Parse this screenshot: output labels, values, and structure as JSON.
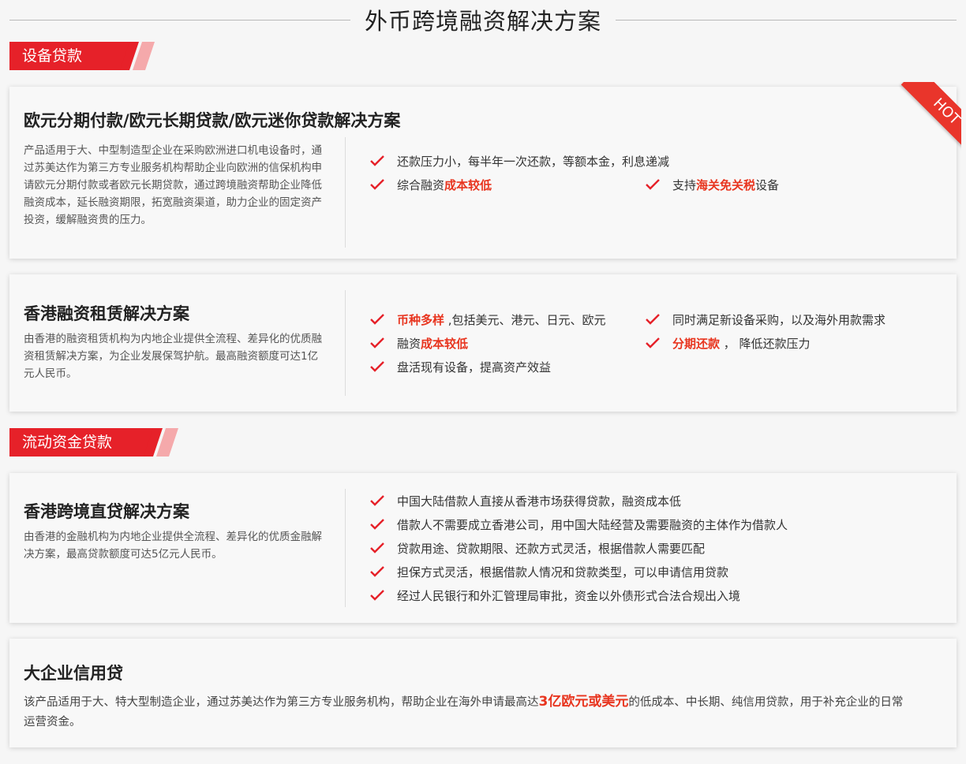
{
  "page_title": "外币跨境融资解决方案",
  "colors": {
    "accent": "#e62129",
    "highlight": "#e8351f"
  },
  "sections": [
    {
      "tag": "设备贷款",
      "cards": [
        {
          "title": "欧元分期付款/欧元长期贷款/欧元迷你贷款解决方案",
          "badge": "HOT",
          "description": "产品适用于大、中型制造型企业在采购欧洲进口机电设备时，通过苏美达作为第三方专业服务机构帮助企业向欧洲的信保机构申请欧元分期付款或者欧元长期贷款，通过跨境融资帮助企业降低融资成本，延长融资期限，拓宽融资渠道，助力企业的固定资产投资，缓解融资贵的压力。",
          "features": [
            {
              "plain_before": "还款压力小，每半年一次还款，等额本金，利息递减",
              "highlight": "",
              "plain_after": ""
            },
            {
              "plain_before": "综合融资",
              "highlight": "成本较低",
              "plain_after": ""
            },
            {
              "plain_before": "支持",
              "highlight": "海关免关税",
              "plain_after": "设备"
            }
          ]
        }
      ]
    },
    {
      "cards": [
        {
          "title": "香港融资租赁解决方案",
          "description": "由香港的融资租赁机构为内地企业提供全流程、差异化的优质融资租赁解决方案，为企业发展保驾护航。最高融资额度可达1亿元人民币。",
          "features": [
            {
              "plain_before": "",
              "highlight": "币种多样",
              "plain_after": " ,包括美元、港元、日元、欧元"
            },
            {
              "plain_before": "同时满足新设备采购，以及海外用款需求",
              "highlight": "",
              "plain_after": ""
            },
            {
              "plain_before": "融资",
              "highlight": "成本较低",
              "plain_after": ""
            },
            {
              "plain_before": "",
              "highlight": "分期还款",
              "plain_after": " ，  降低还款压力"
            },
            {
              "plain_before": "盘活现有设备，提高资产效益",
              "highlight": "",
              "plain_after": ""
            }
          ]
        }
      ]
    },
    {
      "tag": "流动资金贷款",
      "cards": [
        {
          "title": "香港跨境直贷解决方案",
          "description": "由香港的金融机构为内地企业提供全流程、差异化的优质金融解决方案，最高贷款额度可达5亿元人民币。",
          "features": [
            {
              "plain_before": "中国大陆借款人直接从香港市场获得贷款，融资成本低",
              "highlight": "",
              "plain_after": ""
            },
            {
              "plain_before": "借款人不需要成立香港公司，用中国大陆经营及需要融资的主体作为借款人",
              "highlight": "",
              "plain_after": ""
            },
            {
              "plain_before": "贷款用途、贷款期限、还款方式灵活，根据借款人需要匹配",
              "highlight": "",
              "plain_after": ""
            },
            {
              "plain_before": "担保方式灵活，根据借款人情况和贷款类型，可以申请信用贷款",
              "highlight": "",
              "plain_after": ""
            },
            {
              "plain_before": "经过人民银行和外汇管理局审批，资金以外债形式合法合规出入境",
              "highlight": "",
              "plain_after": ""
            }
          ]
        },
        {
          "title": "大企业信用贷",
          "desc_before": "该产品适用于大、特大型制造企业，通过苏美达作为第三方专业服务机构，帮助企业在海外申请最高达",
          "desc_highlight": "3亿欧元或美元",
          "desc_after": "的低成本、中长期、纯信用贷款，用于补充企业的日常运营资金。"
        }
      ]
    }
  ]
}
